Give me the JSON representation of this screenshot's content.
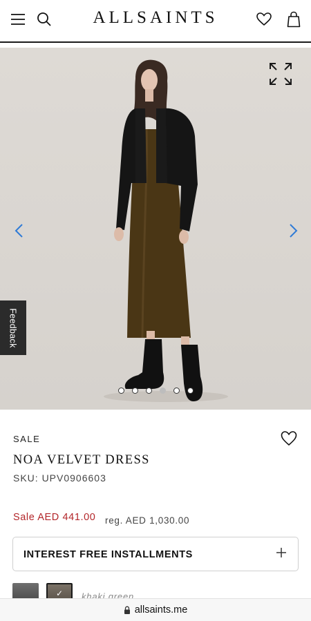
{
  "header": {
    "menu_icon": "hamburger-menu-icon",
    "search_icon": "search-icon",
    "brand": "ALLSAINTS",
    "wishlist_icon": "heart-icon",
    "bag_icon": "shopping-bag-icon"
  },
  "gallery": {
    "expand_icon": "expand-icon",
    "prev_icon": "chevron-left-icon",
    "next_icon": "chevron-right-icon",
    "slide_count": 6,
    "active_slide": 4,
    "accent_color": "#2f7bd6"
  },
  "feedback": {
    "label": "Feedback"
  },
  "product": {
    "badge": "SALE",
    "name": "NOA VELVET DRESS",
    "sku": "SKU: UPV0906603",
    "sale_price": "Sale AED 441.00",
    "regular_price": "reg. AED 1,030.00",
    "sale_color": "#b3262a",
    "wishlist_icon": "heart-outline-icon"
  },
  "installments": {
    "label": "INTEREST FREE INSTALLMENTS",
    "icon": "plus-icon"
  },
  "colors": {
    "selected_name": "khaki green",
    "swatches": [
      {
        "name": "grey",
        "selected": false
      },
      {
        "name": "khaki green",
        "selected": true
      }
    ]
  },
  "browser": {
    "url": "allsaints.me",
    "lock_icon": "lock-icon"
  }
}
